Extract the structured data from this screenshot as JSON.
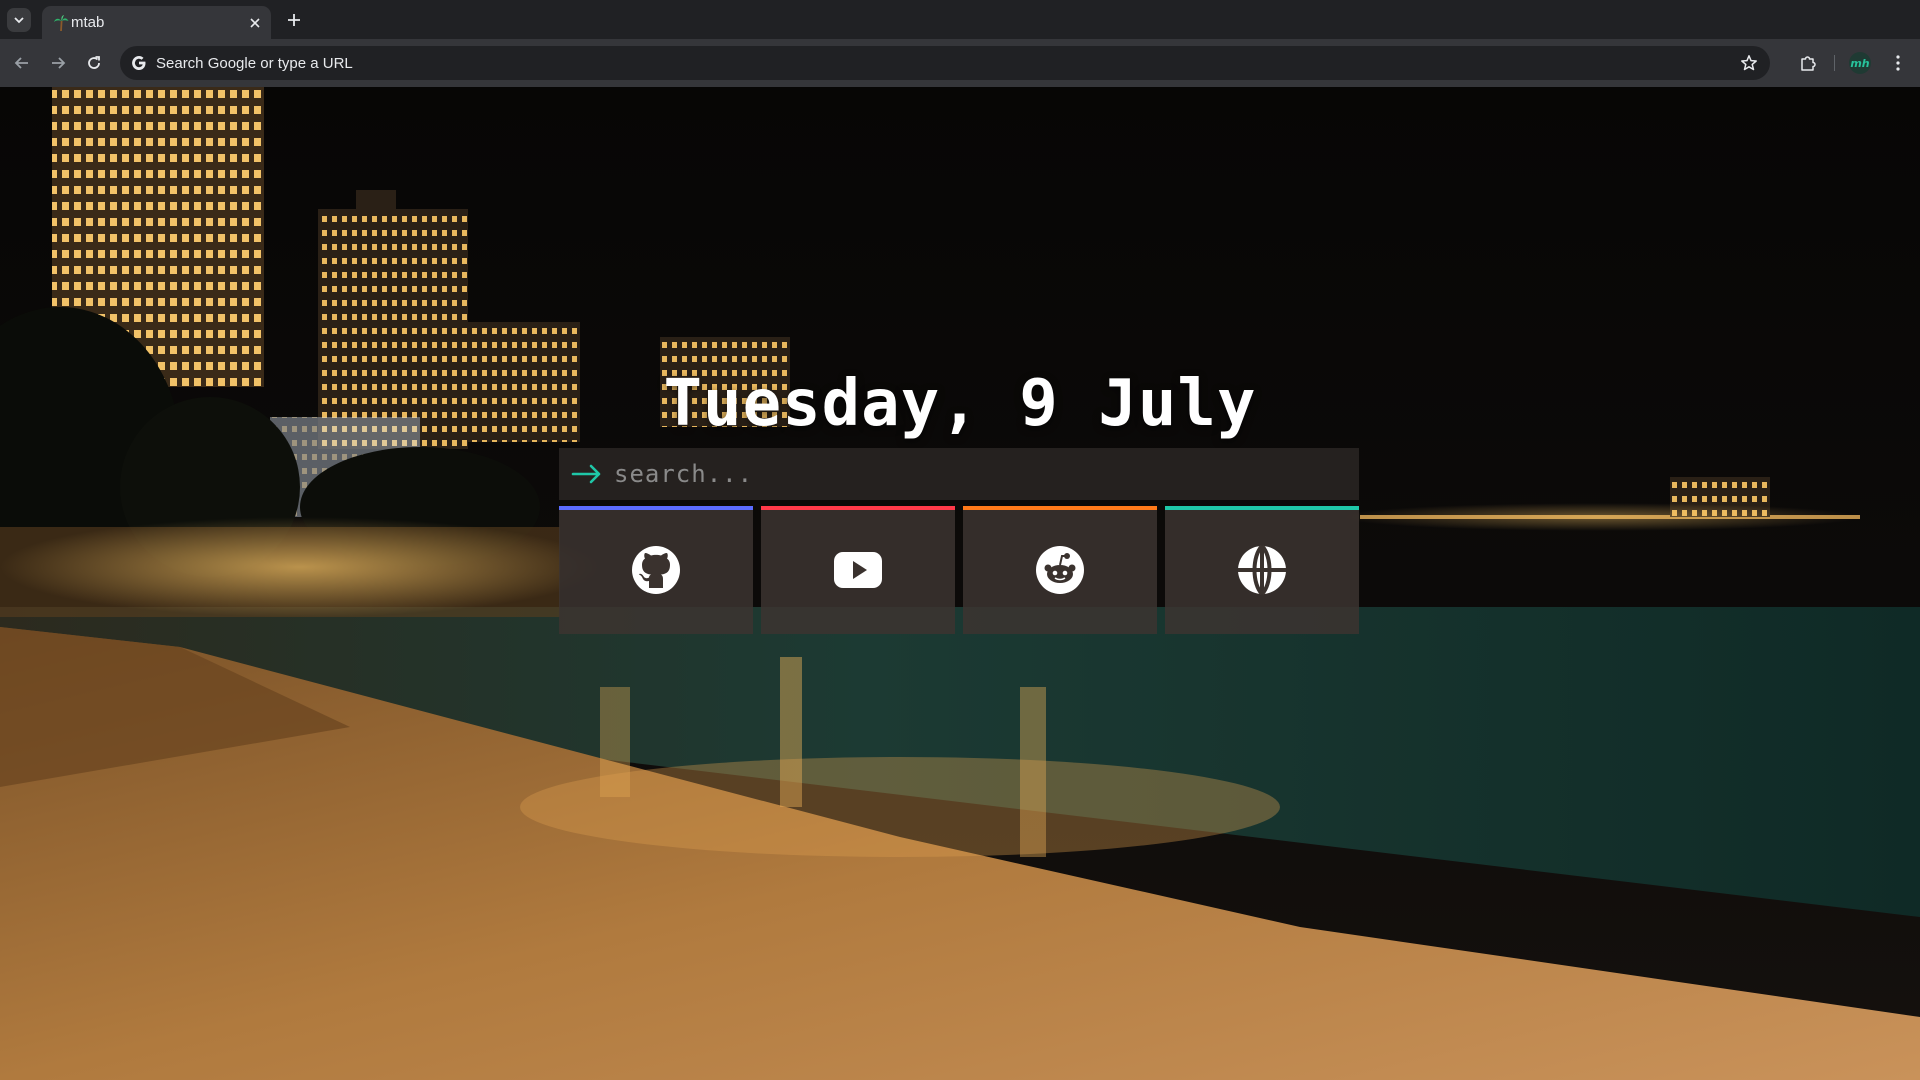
{
  "browser": {
    "tab": {
      "title": "mtab"
    },
    "omnibox": {
      "placeholder": "Search Google or type a URL"
    },
    "profile": {
      "initials": "mh"
    }
  },
  "content": {
    "date": "Tuesday, 9 July",
    "search": {
      "placeholder": "search..."
    },
    "bookmarks": [
      {
        "name": "GitHub",
        "icon": "github-icon",
        "accent": "#5b6cff"
      },
      {
        "name": "YouTube",
        "icon": "youtube-icon",
        "accent": "#ff3a4a"
      },
      {
        "name": "Reddit",
        "icon": "reddit-icon",
        "accent": "#ff7a1a"
      },
      {
        "name": "Website",
        "icon": "globe-icon",
        "accent": "#1fc7a8"
      }
    ]
  },
  "colors": {
    "accent": "#1fc7a8",
    "chrome_bg": "#202124",
    "toolbar_bg": "#35363a"
  }
}
